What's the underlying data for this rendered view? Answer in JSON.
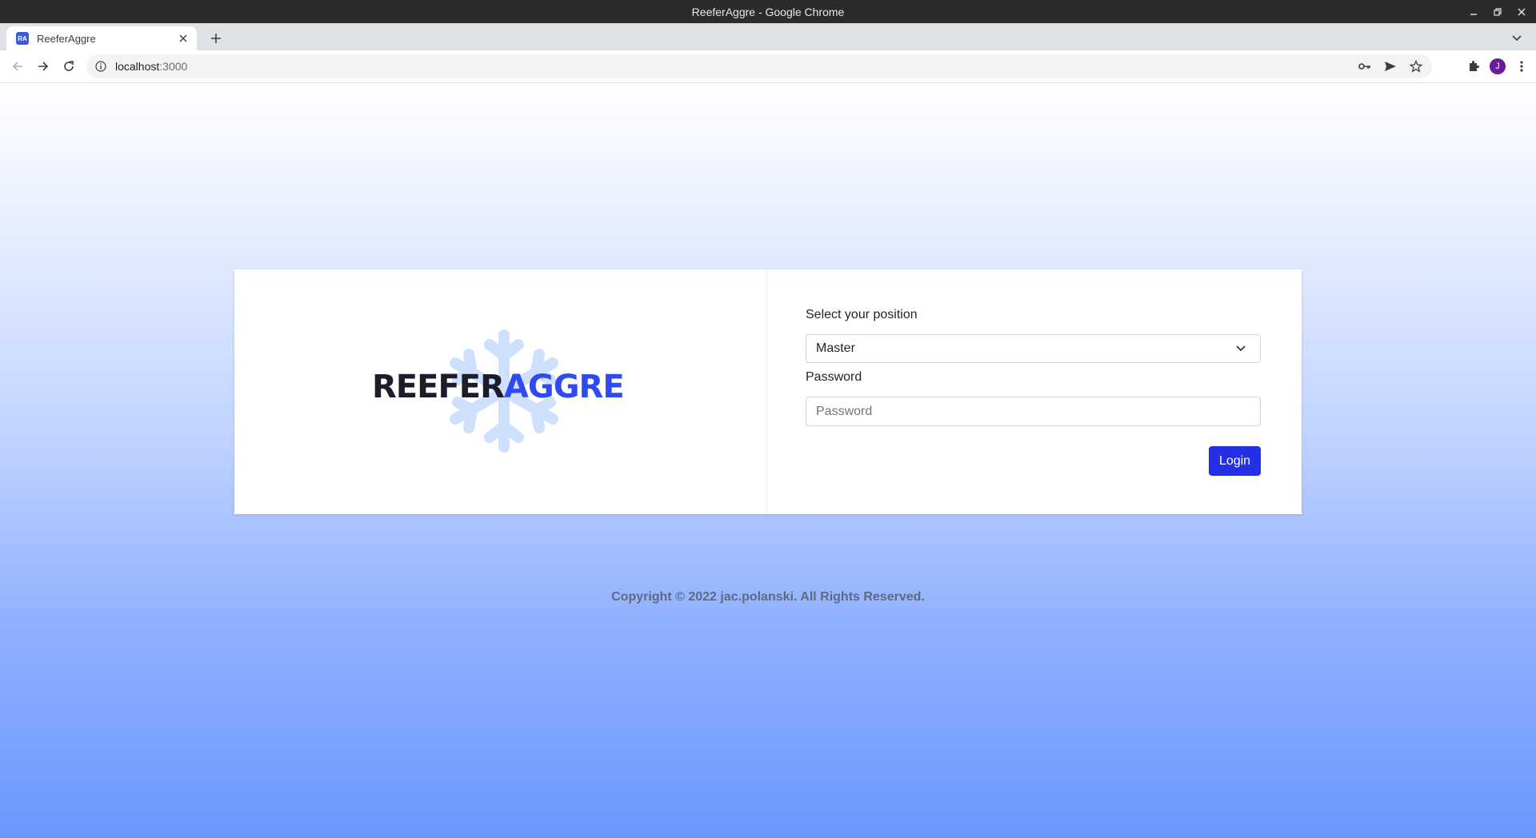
{
  "window": {
    "title": "ReeferAggre - Google Chrome"
  },
  "tabs": [
    {
      "label": "ReeferAggre",
      "favicon_text": "RA"
    }
  ],
  "address_bar": {
    "host": "localhost",
    "port": ":3000"
  },
  "logo": {
    "part1": "REEFER",
    "part2": "AGGRE",
    "brand_color": "#2f4bf0"
  },
  "login_form": {
    "position_label": "Select your position",
    "position_value": "Master",
    "password_label": "Password",
    "password_placeholder": "Password",
    "login_button": "Login"
  },
  "footer": {
    "copyright": "Copyright © 2022 jac.polanski. All Rights Reserved."
  },
  "profile": {
    "initial": "J"
  },
  "colors": {
    "accent": "#2430e6",
    "page_gradient_end": "#6a97ff"
  }
}
